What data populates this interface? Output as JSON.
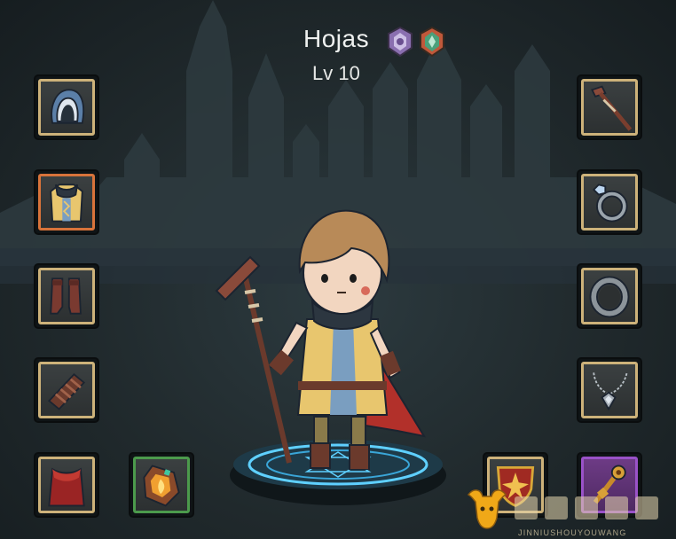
{
  "character": {
    "name": "Hojas",
    "level": "Lv 10",
    "badges": [
      {
        "icon": "purple-crest-icon",
        "color": "#8a6fb0"
      },
      {
        "icon": "green-crest-icon",
        "color": "#4aa07a"
      }
    ]
  },
  "equipment": {
    "left": [
      {
        "slot": "head",
        "icon": "hood-icon",
        "frame": "gold"
      },
      {
        "slot": "body",
        "icon": "robe-icon",
        "frame": "orange"
      },
      {
        "slot": "legs",
        "icon": "boots-icon",
        "frame": "gold"
      },
      {
        "slot": "arm",
        "icon": "bracer-icon",
        "frame": "gold"
      },
      {
        "slot": "cape",
        "icon": "cape-icon",
        "frame": "gold"
      },
      {
        "slot": "gem",
        "icon": "fire-gem-icon",
        "frame": "green"
      }
    ],
    "right": [
      {
        "slot": "weapon",
        "icon": "staff-icon",
        "frame": "gold"
      },
      {
        "slot": "ring-1",
        "icon": "gem-ring-icon",
        "frame": "gold"
      },
      {
        "slot": "ring-2",
        "icon": "band-ring-icon",
        "frame": "gold"
      },
      {
        "slot": "amulet",
        "icon": "amulet-icon",
        "frame": "gold"
      },
      {
        "slot": "shield",
        "icon": "shield-icon",
        "frame": "gold"
      },
      {
        "slot": "relic",
        "icon": "relic-icon",
        "frame": "purple"
      }
    ]
  },
  "watermark": {
    "text": "JINNIUSHOUYOUWANG",
    "logo_icon": "golden-ox-icon"
  },
  "colors": {
    "gold_frame": "#cdb27a",
    "orange_frame": "#d8733a",
    "green_frame": "#4c9a4c",
    "purple_frame": "#9a52c8",
    "pedestal_glow": "#5fd0ff"
  }
}
